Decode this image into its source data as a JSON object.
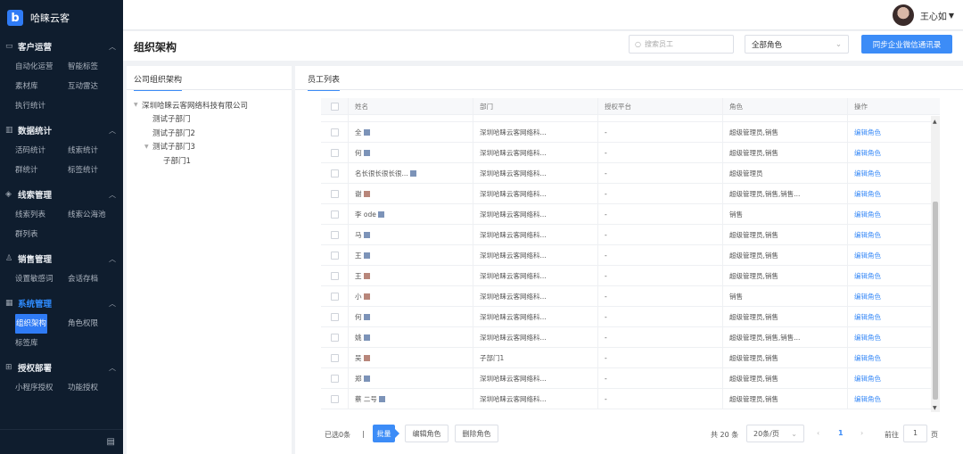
{
  "app": {
    "name": "哈睐云客",
    "logo_letter": "b"
  },
  "user": {
    "name": "王心如",
    "dropdown_icon": "caret-down-icon"
  },
  "sidebar": {
    "sections": [
      {
        "icon": "chat-icon",
        "title": "客户运营",
        "items": [
          "自动化运营",
          "智能标签",
          "素材库",
          "互动雷达",
          "执行统计"
        ]
      },
      {
        "icon": "bar-chart-icon",
        "title": "数据统计",
        "items": [
          "活码统计",
          "线索统计",
          "群统计",
          "标签统计"
        ]
      },
      {
        "icon": "target-icon",
        "title": "线索管理",
        "items": [
          "线索列表",
          "线索公海池",
          "群列表"
        ]
      },
      {
        "icon": "person-icon",
        "title": "销售管理",
        "items": [
          "设置敏感词",
          "会话存档"
        ]
      },
      {
        "icon": "grid-icon",
        "title": "系统管理",
        "items": [
          "组织架构",
          "角色权限",
          "标签库"
        ]
      },
      {
        "icon": "org-icon",
        "title": "授权部署",
        "items": [
          "小程序授权",
          "功能授权"
        ]
      }
    ],
    "collapse_icon": "collapse-icon"
  },
  "header": {
    "title": "组织架构",
    "search_placeholder": "搜索员工",
    "role_select": "全部角色",
    "sync_button": "同步企业微信通讯录"
  },
  "org_panel": {
    "tab": "公司组织架构",
    "tree": [
      {
        "label": "深圳哈睐云客网络科技有限公司",
        "level": 0,
        "expanded": true
      },
      {
        "label": "测试子部门",
        "level": 1
      },
      {
        "label": "测试子部门2",
        "level": 1
      },
      {
        "label": "测试子部门3",
        "level": 1,
        "expanded": true
      },
      {
        "label": "子部门1",
        "level": 2
      }
    ]
  },
  "employee_panel": {
    "tab": "员工列表",
    "columns": [
      "姓名",
      "部门",
      "授权平台",
      "角色",
      "操作"
    ],
    "rows": [
      {
        "name": "全",
        "dept": "深圳哈睐云客网络科...",
        "platform": "-",
        "role": "超级管理员,销售",
        "action": "编辑角色"
      },
      {
        "name": "何",
        "dept": "深圳哈睐云客网络科...",
        "platform": "-",
        "role": "超级管理员,销售",
        "action": "编辑角色"
      },
      {
        "name": "名长很长很长很...",
        "dept": "深圳哈睐云客网络科...",
        "platform": "-",
        "role": "超级管理员",
        "action": "编辑角色"
      },
      {
        "name": "谢",
        "dept": "深圳哈睐云客网络科...",
        "platform": "-",
        "role": "超级管理员,销售,销售...",
        "action": "编辑角色"
      },
      {
        "name": "李 ode",
        "dept": "深圳哈睐云客网络科...",
        "platform": "-",
        "role": "销售",
        "action": "编辑角色"
      },
      {
        "name": "马",
        "dept": "深圳哈睐云客网络科...",
        "platform": "-",
        "role": "超级管理员,销售",
        "action": "编辑角色"
      },
      {
        "name": "王",
        "dept": "深圳哈睐云客网络科...",
        "platform": "-",
        "role": "超级管理员,销售",
        "action": "编辑角色"
      },
      {
        "name": "王",
        "dept": "深圳哈睐云客网络科...",
        "platform": "-",
        "role": "超级管理员,销售",
        "action": "编辑角色"
      },
      {
        "name": "小",
        "dept": "深圳哈睐云客网络科...",
        "platform": "-",
        "role": "销售",
        "action": "编辑角色"
      },
      {
        "name": "何",
        "dept": "深圳哈睐云客网络科...",
        "platform": "-",
        "role": "超级管理员,销售",
        "action": "编辑角色"
      },
      {
        "name": "姚",
        "dept": "深圳哈睐云客网络科...",
        "platform": "-",
        "role": "超级管理员,销售,销售...",
        "action": "编辑角色"
      },
      {
        "name": "吴",
        "dept": "子部门1",
        "platform": "-",
        "role": "超级管理员,销售",
        "action": "编辑角色"
      },
      {
        "name": "郑",
        "dept": "深圳哈睐云客网络科...",
        "platform": "-",
        "role": "超级管理员,销售",
        "action": "编辑角色"
      },
      {
        "name": "蔡 二号",
        "dept": "深圳哈睐云客网络科...",
        "platform": "-",
        "role": "超级管理员,销售",
        "action": "编辑角色"
      }
    ]
  },
  "footer": {
    "selected": "已选0条",
    "batch_button": "批量",
    "edit_role_button": "编辑角色",
    "delete_role_button": "删除角色",
    "total": "共 20 条",
    "page_size": "20条/页",
    "current_page": "1",
    "goto_label": "前往",
    "goto_value": "1",
    "page_suffix": "页"
  }
}
